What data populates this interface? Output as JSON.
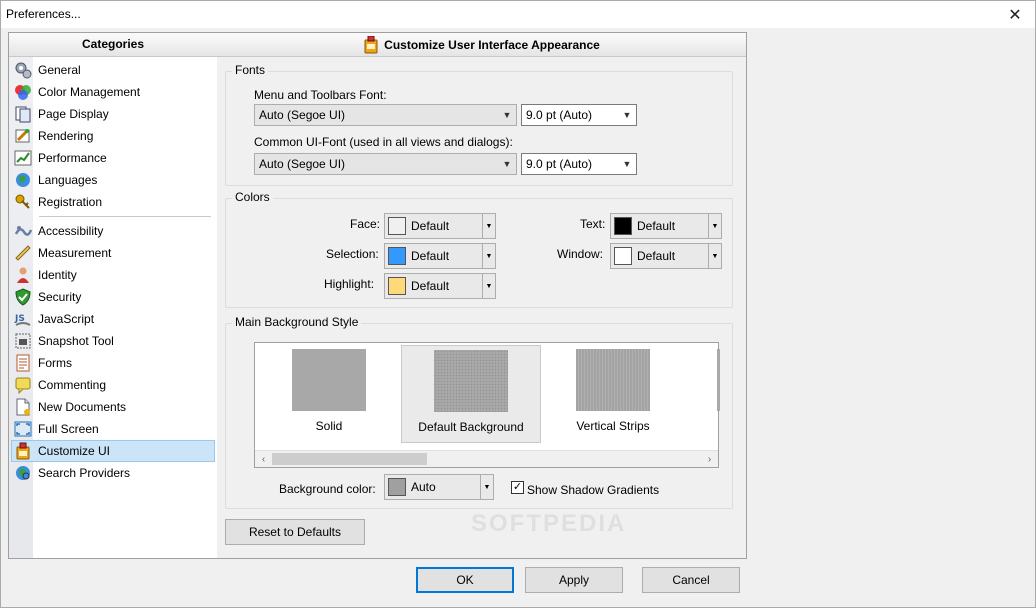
{
  "window": {
    "title": "Preferences...",
    "close_glyph": "✕"
  },
  "categories": {
    "header": "Categories",
    "items": [
      {
        "label": "General",
        "icon": "gears-icon"
      },
      {
        "label": "Color Management",
        "icon": "color-circles-icon"
      },
      {
        "label": "Page Display",
        "icon": "page-display-icon"
      },
      {
        "label": "Rendering",
        "icon": "rendering-icon"
      },
      {
        "label": "Performance",
        "icon": "performance-chart-icon"
      },
      {
        "label": "Languages",
        "icon": "globe-icon"
      },
      {
        "label": "Registration",
        "icon": "key-icon"
      },
      {
        "label": "Accessibility",
        "icon": "accessibility-icon"
      },
      {
        "label": "Measurement",
        "icon": "ruler-icon"
      },
      {
        "label": "Identity",
        "icon": "person-icon"
      },
      {
        "label": "Security",
        "icon": "shield-icon"
      },
      {
        "label": "JavaScript",
        "icon": "javascript-icon"
      },
      {
        "label": "Snapshot Tool",
        "icon": "camera-icon"
      },
      {
        "label": "Forms",
        "icon": "form-icon"
      },
      {
        "label": "Commenting",
        "icon": "comment-icon"
      },
      {
        "label": "New Documents",
        "icon": "new-document-icon"
      },
      {
        "label": "Full Screen",
        "icon": "fullscreen-icon"
      },
      {
        "label": "Customize UI",
        "icon": "customize-ui-icon"
      },
      {
        "label": "Search Providers",
        "icon": "search-globe-icon"
      }
    ],
    "selected": "Customize UI"
  },
  "panel": {
    "title": "Customize User Interface Appearance",
    "fonts": {
      "group_label": "Fonts",
      "menu_font_label": "Menu and Toolbars Font:",
      "menu_font_value": "Auto (Segoe UI)",
      "menu_size_value": "9.0 pt (Auto)",
      "ui_font_label": "Common UI-Font (used in all views and dialogs):",
      "ui_font_value": "Auto (Segoe UI)",
      "ui_size_value": "9.0 pt (Auto)"
    },
    "colors": {
      "group_label": "Colors",
      "face_label": "Face:",
      "face_value": "Default",
      "face_color": "#f0f0f0",
      "selection_label": "Selection:",
      "selection_value": "Default",
      "selection_color": "#3399ff",
      "highlight_label": "Highlight:",
      "highlight_value": "Default",
      "highlight_color": "#ffd97a",
      "text_label": "Text:",
      "text_value": "Default",
      "text_color": "#000000",
      "window_label": "Window:",
      "window_value": "Default",
      "window_color": "#ffffff"
    },
    "background": {
      "group_label": "Main Background Style",
      "styles": [
        "Solid",
        "Default Background",
        "Vertical Strips"
      ],
      "selected_style": "Default Background",
      "bg_color_label": "Background color:",
      "bg_color_value": "Auto",
      "bg_color_swatch": "#a0a0a0",
      "shadow_label": "Show Shadow Gradients",
      "shadow_checked": true
    },
    "reset_label": "Reset to Defaults"
  },
  "buttons": {
    "ok": "OK",
    "apply": "Apply",
    "cancel": "Cancel"
  },
  "watermark": "SOFTPEDIA"
}
